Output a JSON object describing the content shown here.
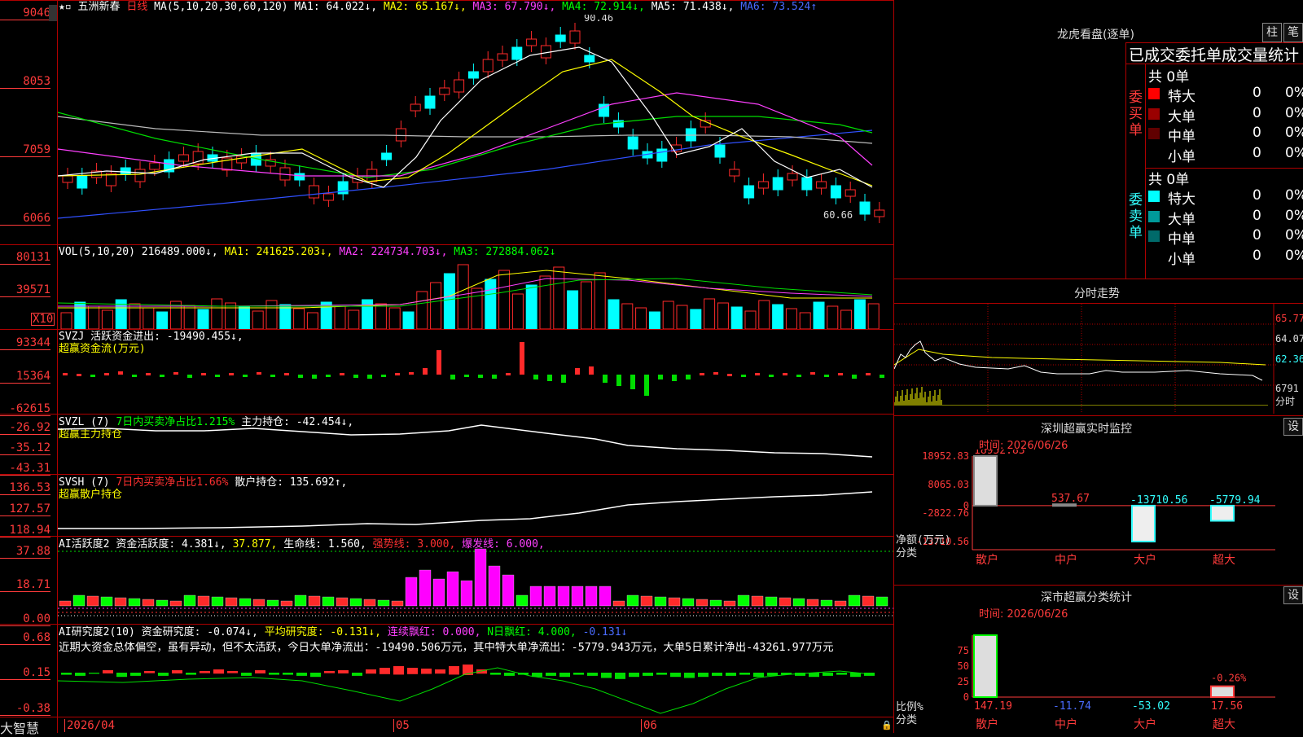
{
  "stock": {
    "name": "五洲新春",
    "period": "日线"
  },
  "colors": {
    "up": "#ff2a2a",
    "down": "#00ffff",
    "grid": "#b00000",
    "ma1": "#ffffff",
    "ma2": "#ffff00",
    "ma3": "#ff40ff",
    "ma4": "#00dd00",
    "ma5": "#bbbbbb",
    "ma6": "#3050ff"
  },
  "price_panel": {
    "ma_label": "MA(5,10,20,30,60,120)",
    "ma1": "MA1: 64.022↓,",
    "ma2": "MA2: 65.167↓,",
    "ma3": "MA3: 67.790↓,",
    "ma4": "MA4: 72.914↓,",
    "ma5": "MA5: 71.438↓,",
    "ma6": "MA6: 73.524↑",
    "y_ticks": [
      "9046",
      "8053",
      "7059",
      "6066"
    ],
    "high_label": "90.46",
    "low_label": "60.66"
  },
  "vol_panel": {
    "label": "VOL(5,10,20)",
    "value": "216489.000↓,",
    "ma1": "MA1: 241625.203↓,",
    "ma2": "MA2: 224734.703↓,",
    "ma3": "MA3: 272884.062↓",
    "y_ticks": [
      "80131",
      "39571"
    ],
    "unit": "X10"
  },
  "svzj_panel": {
    "title": "SVZJ",
    "line1": "活跃资金进出: -19490.455↓,",
    "line2": "超赢资金流(万元)",
    "y_ticks": [
      "93344",
      "15364",
      "-62615"
    ]
  },
  "svzl_panel": {
    "title": "SVZL  (7)",
    "ratio": "7日内买卖净占比1.215%",
    "hold": "主力持仓: -42.454↓,",
    "line2": "超赢主力持仓",
    "y_ticks": [
      "-26.92",
      "-35.12",
      "-43.31"
    ]
  },
  "svsh_panel": {
    "title": "SVSH  (7)",
    "ratio": "7日内买卖净占比1.66%",
    "hold": "散户持仓: 135.692↑,",
    "line2": "超赢散户持仓",
    "y_ticks": [
      "136.53",
      "127.57",
      "118.94"
    ]
  },
  "ai_active_panel": {
    "title": "AI活跃度2",
    "v1": "资金活跃度: 4.381↓,",
    "v2": "37.877,",
    "v3": "生命线: 1.560,",
    "v4": "强势线: 3.000,",
    "v5": "爆发线: 6.000,",
    "y_ticks": [
      "37.88",
      "18.71",
      "0.00"
    ]
  },
  "ai_research_panel": {
    "title": "AI研究度2(10)",
    "v1": "资金研究度: -0.074↓,",
    "v2": "平均研究度: -0.131↓,",
    "v3": "连续飘红: 0.000,",
    "v4": "N日飘红: 4.000,",
    "v5": "-0.131↓",
    "comment": "近期大资金总体偏空，虽有异动，但不太活跃，今日大单净流出：-19490.506万元，其中特大单净流出：-5779.943万元，大单5日累计净出-43261.977万元",
    "y_ticks": [
      "0.68",
      "0.15",
      "-0.38"
    ]
  },
  "x_axis": {
    "labels": [
      "2026/04",
      "05",
      "06"
    ]
  },
  "footer": {
    "brand": "大智慧"
  },
  "right": {
    "title": "龙虎看盘(逐单)",
    "btn_zhu": "柱",
    "btn_bi": "笔",
    "stats_title": "已成交委托单成交量统计",
    "buy_label": "委买单",
    "sell_label": "委卖单",
    "buy_total": "共 0单",
    "sell_total": "共 0单",
    "buy_rows": [
      {
        "name": "特大",
        "count": "0",
        "pct": "0%",
        "color": "#ff0000"
      },
      {
        "name": "大单",
        "count": "0",
        "pct": "0%",
        "color": "#9a0000"
      },
      {
        "name": "中单",
        "count": "0",
        "pct": "0%",
        "color": "#600000"
      },
      {
        "name": "小单",
        "count": "0",
        "pct": "0%",
        "color": "#000000"
      }
    ],
    "sell_rows": [
      {
        "name": "特大",
        "count": "0",
        "pct": "0%",
        "color": "#00ffff"
      },
      {
        "name": "大单",
        "count": "0",
        "pct": "0%",
        "color": "#009a9a"
      },
      {
        "name": "中单",
        "count": "0",
        "pct": "0%",
        "color": "#006a6a"
      },
      {
        "name": "小单",
        "count": "0",
        "pct": "0%",
        "color": "#000000"
      }
    ],
    "intraday": {
      "title": "分时走势",
      "ticks": [
        "65.77",
        "64.07",
        "62.36",
        "6791"
      ],
      "unit": "分时"
    },
    "monitor": {
      "title": "深圳超赢实时监控",
      "btn": "设",
      "time": "时间: 2026/06/26",
      "y_ticks": [
        "18952.83",
        "8065.03",
        "0",
        "-2822.76",
        "-13710.56"
      ],
      "ylabel": "净额(万元)",
      "xlabel": "分类",
      "categories": [
        "散户",
        "中户",
        "大户",
        "超大"
      ],
      "values": [
        18952.83,
        537.67,
        -13710.56,
        -5779.94
      ],
      "value_labels": [
        "18952.83",
        "537.67",
        "-13710.56",
        "-5779.94"
      ],
      "ylim": [
        -13710.56,
        18952.83
      ]
    },
    "classify": {
      "title": "深市超赢分类统计",
      "btn": "设",
      "time": "时间: 2026/06/26",
      "y_ticks": [
        "75",
        "50",
        "25",
        "0"
      ],
      "ylabel": "比例%",
      "xlabel": "分类",
      "categories": [
        "散户",
        "中户",
        "大户",
        "超大"
      ],
      "values": [
        147.19,
        -11.74,
        -53.02,
        17.56
      ],
      "value_labels": [
        "147.19",
        "-11.74",
        "-53.02",
        "17.56"
      ],
      "extra_label": "-0.26%"
    }
  }
}
